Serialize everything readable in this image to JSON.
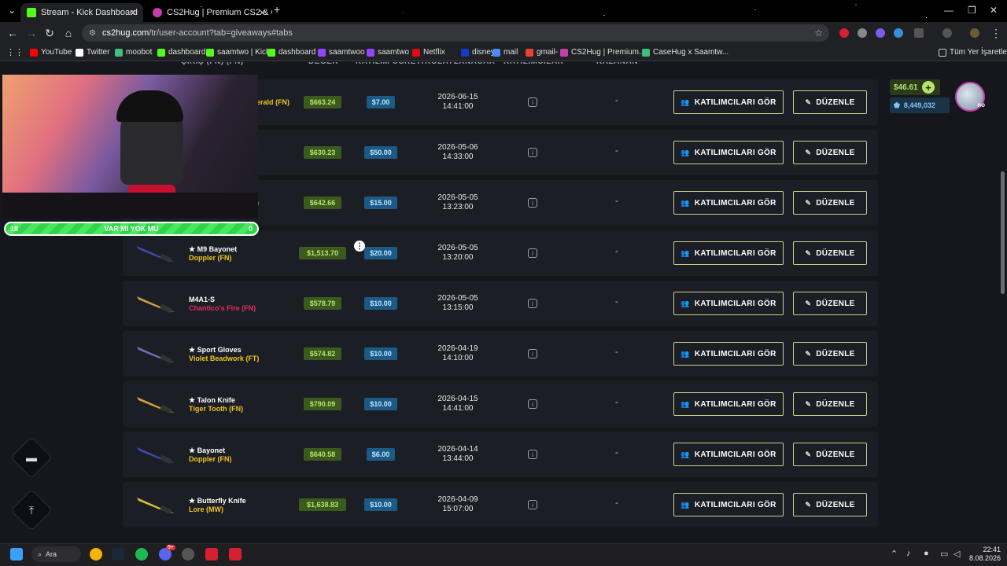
{
  "tabs": [
    {
      "title": "Stream - Kick Dashboard",
      "active": true,
      "favicon_color": "#53fc18"
    },
    {
      "title": "CS2Hug | Premium CS2 & CS:G",
      "active": false,
      "favicon_color": "#c43ea6"
    }
  ],
  "new_tab_label": "+",
  "address": {
    "domain": "cs2hug.com",
    "path": "/tr/user-account?tab=giveaways#tabs"
  },
  "bookmarks": [
    {
      "label": "YouTube",
      "color": "#ff0000"
    },
    {
      "label": "Twitter",
      "color": "#ffffff"
    },
    {
      "label": "moobot",
      "color": "#3fbf7f"
    },
    {
      "label": "dashboard",
      "color": "#53fc18"
    },
    {
      "label": "saamtwo | Kick",
      "color": "#53fc18"
    },
    {
      "label": "dashboard",
      "color": "#53fc18"
    },
    {
      "label": "saamtwoo",
      "color": "#9146ff"
    },
    {
      "label": "saamtwo",
      "color": "#9146ff"
    },
    {
      "label": "Netflix",
      "color": "#e50914"
    },
    {
      "label": "disney+",
      "color": "#113ccf"
    },
    {
      "label": "mail",
      "color": "#4a8af4"
    },
    {
      "label": "gmail-",
      "color": "#ea4335"
    },
    {
      "label": "CS2Hug | Premium...",
      "color": "#c43ea6"
    },
    {
      "label": "CaseHug x Saamtw...",
      "color": "#3fbf7f"
    }
  ],
  "all_bookmarks_label": "Tüm Yer İşaretleri",
  "table_headers": [
    "ÇIKIŞ (FN) (FN)",
    "DEĞER",
    "KATILIM ÜCRETİ",
    "KOLAYLANACAK",
    "KATILIMCILAR",
    "KAZANAN"
  ],
  "header": {
    "balance": "$46.61",
    "coins": "8,449,032",
    "add_label": "+",
    "avatar_badge": "no"
  },
  "poll": {
    "left": "18",
    "label": "VAR MI YOK MU",
    "right": "0"
  },
  "buttons": {
    "participants": "KATILIMCILARI GÖR",
    "edit": "DÜZENLE"
  },
  "rows": [
    {
      "name": "",
      "finish": "erald (FN)",
      "finish_color": "#f0c419",
      "value": "$663.24",
      "entry": "$7.00",
      "date": "2026-06-15",
      "time": "14:41:00",
      "winner": "-"
    },
    {
      "name": "",
      "finish": "",
      "finish_color": "#f0c419",
      "value": "$630.23",
      "entry": "$50.00",
      "date": "2026-05-06",
      "time": "14:33:00",
      "winner": "-"
    },
    {
      "name": "",
      "finish": ")",
      "finish_color": "#f0c419",
      "value": "$642.66",
      "entry": "$15.00",
      "date": "2026-05-05",
      "time": "13:23:00",
      "winner": "-"
    },
    {
      "name": "★ M9 Bayonet",
      "finish": "Doppler (FN)",
      "finish_color": "#f0c419",
      "value": "$1,513.70",
      "entry": "$20.00",
      "date": "2026-05-05",
      "time": "13:20:00",
      "winner": "-"
    },
    {
      "name": "M4A1-S",
      "finish": "Chantico's Fire (FN)",
      "finish_color": "#e0305a",
      "value": "$578.79",
      "entry": "$10.00",
      "date": "2026-05-05",
      "time": "13:15:00",
      "winner": "-"
    },
    {
      "name": "★ Sport Gloves",
      "finish": "Violet Beadwork (FT)",
      "finish_color": "#f0c419",
      "value": "$574.82",
      "entry": "$10.00",
      "date": "2026-04-19",
      "time": "14:10:00",
      "winner": "-"
    },
    {
      "name": "★ Talon Knife",
      "finish": "Tiger Tooth (FN)",
      "finish_color": "#f0c419",
      "value": "$790.09",
      "entry": "$10.00",
      "date": "2026-04-15",
      "time": "14:41:00",
      "winner": "-"
    },
    {
      "name": "★ Bayonet",
      "finish": "Doppler (FN)",
      "finish_color": "#f0c419",
      "value": "$640.58",
      "entry": "$6.00",
      "date": "2026-04-14",
      "time": "13:44:00",
      "winner": "-"
    },
    {
      "name": "★ Butterfly Knife",
      "finish": "Lore (MW)",
      "finish_color": "#f0c419",
      "value": "$1,638.83",
      "entry": "$10.00",
      "date": "2026-04-09",
      "time": "15:07:00",
      "winner": "-"
    }
  ],
  "taskbar": {
    "search_label": "Ara",
    "time": "22:41",
    "date": "8.08.2026",
    "discord_badge": "9+"
  }
}
